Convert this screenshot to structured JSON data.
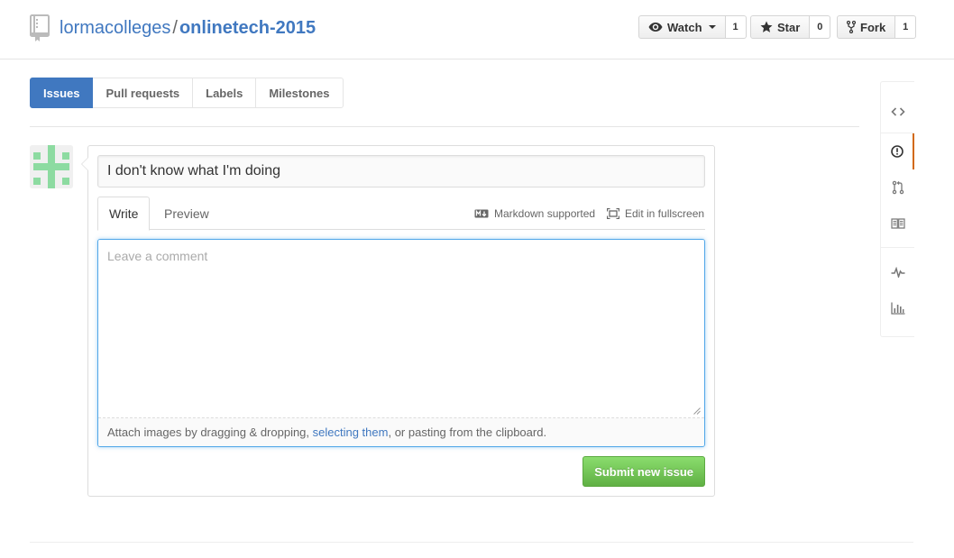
{
  "header": {
    "owner": "lormacolleges",
    "separator": "/",
    "repo": "onlinetech-2015",
    "repo_icon": "repo-icon",
    "actions": [
      {
        "label": "Watch",
        "icon": "eye-icon",
        "count": "1",
        "has_caret": true
      },
      {
        "label": "Star",
        "icon": "star-icon",
        "count": "0"
      },
      {
        "label": "Fork",
        "icon": "fork-icon",
        "count": "1"
      }
    ]
  },
  "subnav": {
    "items": [
      {
        "label": "Issues",
        "selected": true
      },
      {
        "label": "Pull requests"
      },
      {
        "label": "Labels"
      },
      {
        "label": "Milestones"
      }
    ]
  },
  "form": {
    "title_value": "I don't know what I'm doing",
    "tabs": {
      "write": "Write",
      "preview": "Preview"
    },
    "markdown_supported": "Markdown supported",
    "fullscreen": "Edit in fullscreen",
    "comment_placeholder": "Leave a comment",
    "drag_text_before": "Attach images by dragging & dropping, ",
    "drag_link": "selecting them",
    "drag_text_after": ", or pasting from the clipboard.",
    "submit_label": "Submit new issue"
  },
  "reponav": {
    "items": [
      "code-icon",
      "issue-icon",
      "pull-request-icon",
      "wiki-icon",
      "pulse-icon",
      "graph-icon"
    ],
    "selected": "issue-icon"
  },
  "colors": {
    "link": "#4078c0",
    "selected_tab": "#4078c0",
    "submit_green": "#60b044",
    "active_accent": "#d26911",
    "avatar_green": "#8ddba1"
  }
}
